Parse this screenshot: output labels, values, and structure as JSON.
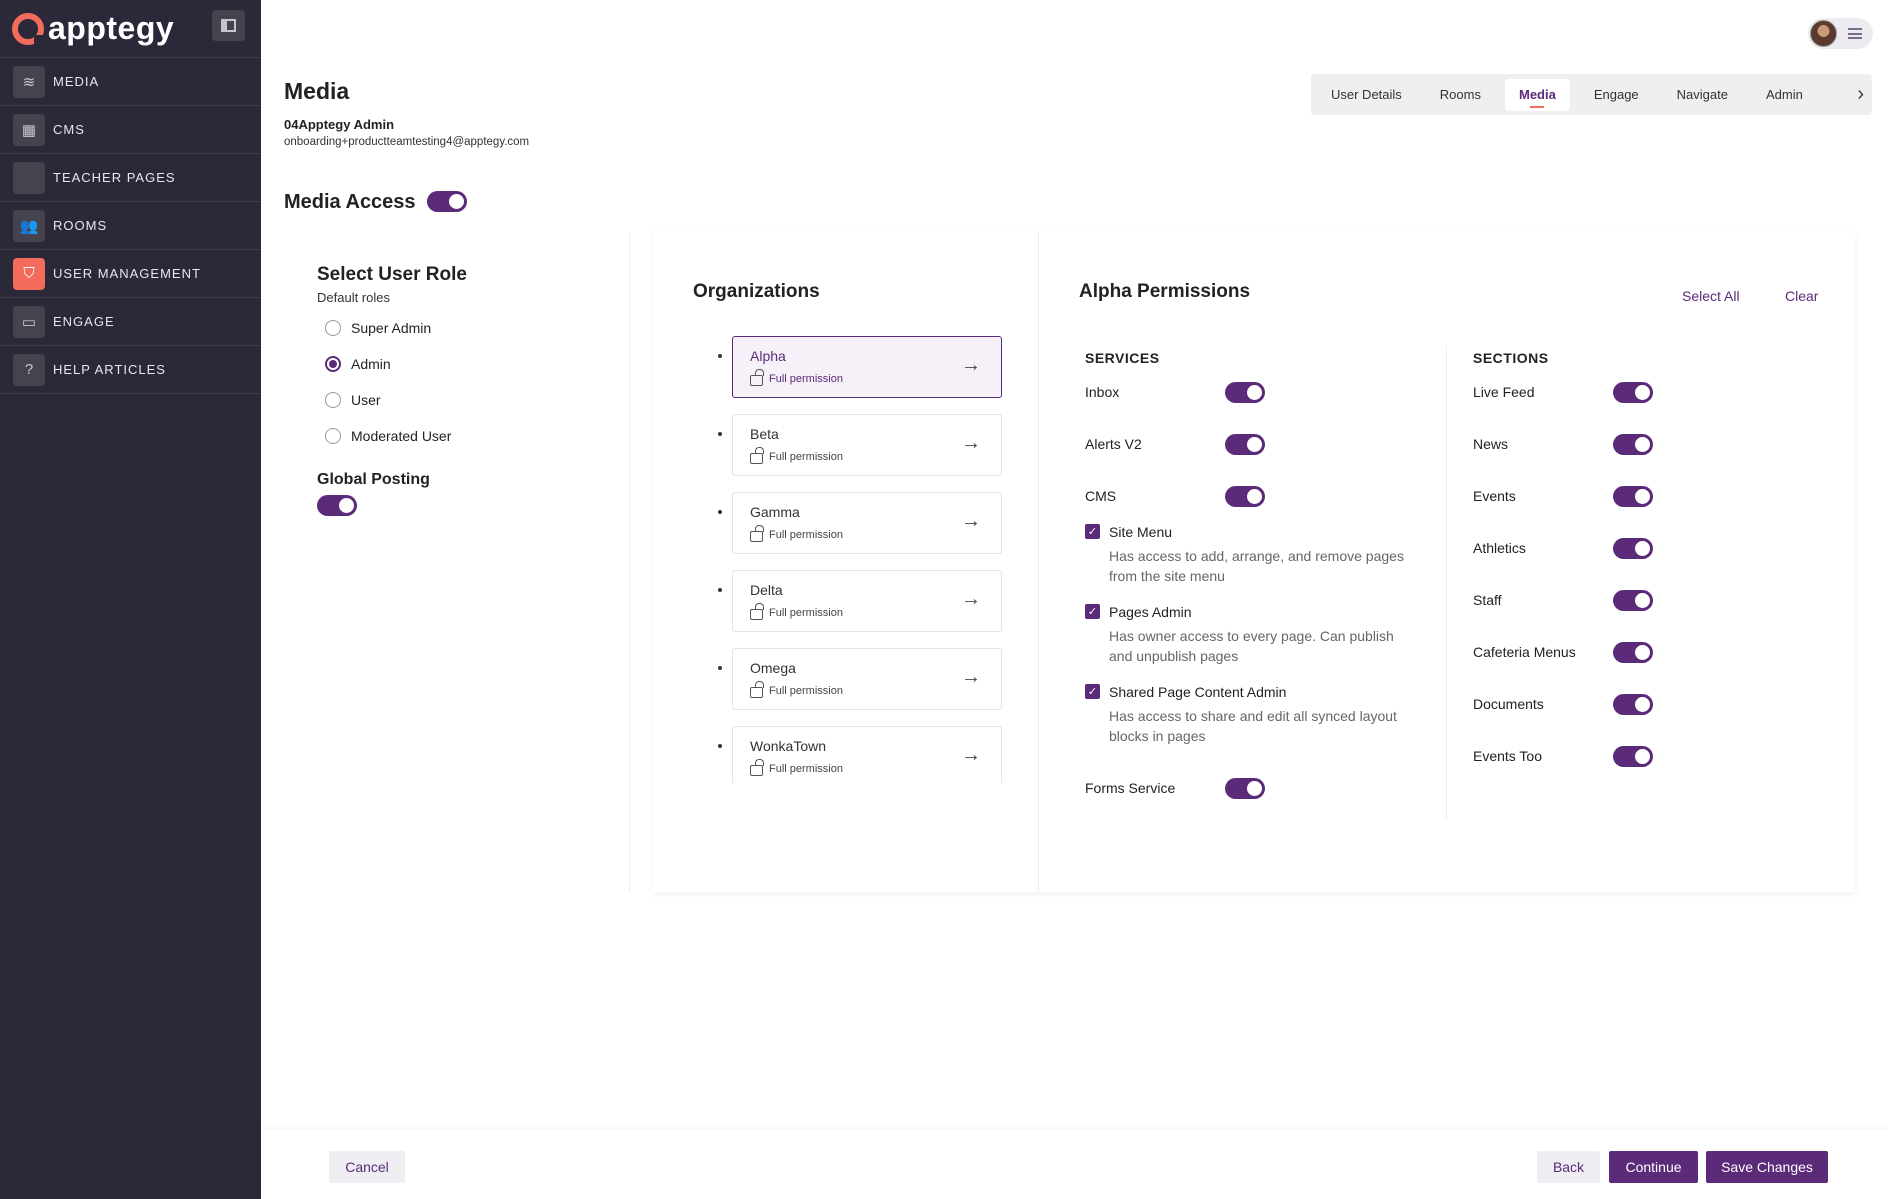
{
  "brand": {
    "name": "apptegy"
  },
  "sidebar": {
    "items": [
      {
        "label": "MEDIA",
        "icon": "layers-icon"
      },
      {
        "label": "CMS",
        "icon": "layout-icon"
      },
      {
        "label": "TEACHER PAGES",
        "icon": "blank-icon"
      },
      {
        "label": "ROOMS",
        "icon": "people-icon"
      },
      {
        "label": "USER MANAGEMENT",
        "icon": "shield-icon",
        "active": true
      },
      {
        "label": "ENGAGE",
        "icon": "chat-icon"
      },
      {
        "label": "HELP ARTICLES",
        "icon": "help-icon"
      }
    ]
  },
  "header": {
    "title": "Media",
    "user_name": "04Apptegy Admin",
    "user_email": "onboarding+productteamtesting4@apptegy.com",
    "tabs": [
      "User Details",
      "Rooms",
      "Media",
      "Engage",
      "Navigate",
      "Admin"
    ],
    "active_tab": "Media"
  },
  "media_access": {
    "label": "Media Access",
    "enabled": true
  },
  "role": {
    "title": "Select User Role",
    "subtitle": "Default roles",
    "options": [
      "Super Admin",
      "Admin",
      "User",
      "Moderated User"
    ],
    "selected": "Admin"
  },
  "global_posting": {
    "label": "Global Posting",
    "enabled": true
  },
  "organizations": {
    "title": "Organizations",
    "items": [
      {
        "name": "Alpha",
        "permission": "Full permission",
        "active": true
      },
      {
        "name": "Beta",
        "permission": "Full permission"
      },
      {
        "name": "Gamma",
        "permission": "Full permission"
      },
      {
        "name": "Delta",
        "permission": "Full permission"
      },
      {
        "name": "Omega",
        "permission": "Full permission"
      },
      {
        "name": "WonkaTown",
        "permission": "Full permission"
      }
    ]
  },
  "permissions": {
    "title": "Alpha Permissions",
    "select_all": "Select All",
    "clear": "Clear",
    "services_heading": "SERVICES",
    "sections_heading": "SECTIONS",
    "services": {
      "inbox": "Inbox",
      "alerts": "Alerts V2",
      "cms": "CMS",
      "forms": "Forms Service"
    },
    "cms_checks": [
      {
        "label": "Site Menu",
        "desc": "Has access to add, arrange, and remove pages from the site menu",
        "checked": true
      },
      {
        "label": "Pages Admin",
        "desc": "Has owner access to every page. Can publish and unpublish pages",
        "checked": true
      },
      {
        "label": "Shared Page Content Admin",
        "desc": "Has access to share and edit all synced layout blocks in pages",
        "checked": true
      }
    ],
    "sections": [
      "Live Feed",
      "News",
      "Events",
      "Athletics",
      "Staff",
      "Cafeteria Menus",
      "Documents",
      "Events Too"
    ]
  },
  "footer": {
    "cancel": "Cancel",
    "back": "Back",
    "continue": "Continue",
    "save": "Save Changes"
  },
  "colors": {
    "accent": "#5b2a78",
    "brand": "#f26b5b",
    "sidebar": "#2b2839"
  }
}
